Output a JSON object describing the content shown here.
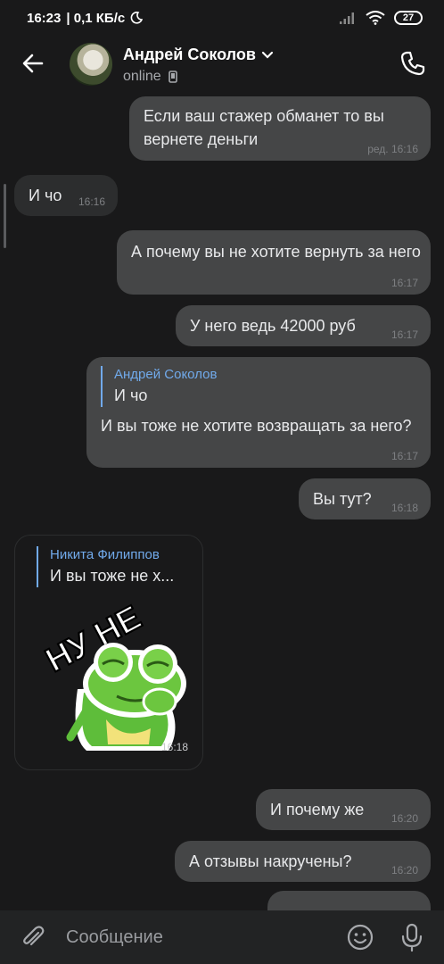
{
  "statusbar": {
    "time": "16:23",
    "speed": "| 0,1 КБ/с",
    "battery": "27"
  },
  "header": {
    "name": "Андрей Соколов",
    "status": "online"
  },
  "messages": [
    {
      "dir": "out",
      "text": "Если ваш стажер обманет то вы вернете деньги",
      "time": "ред. 16:16"
    },
    {
      "dir": "in",
      "text": "И чо",
      "time": "16:16"
    },
    {
      "dir": "out",
      "text": "А почему вы не хотите вернуть за него",
      "time": "16:17"
    },
    {
      "dir": "out",
      "text": "У него ведь 42000 руб",
      "time": "16:17"
    },
    {
      "dir": "out",
      "reply_name": "Андрей Соколов",
      "reply_text": "И чо",
      "text": "И вы тоже не хотите возвращать за него?",
      "time": "16:17"
    },
    {
      "dir": "out",
      "text": "Вы тут?",
      "time": "16:18"
    },
    {
      "dir": "in",
      "reply_name": "Никита Филиппов",
      "reply_text": "И вы тоже не х...",
      "sticker_text": "НУ НЕ",
      "time": "16:18"
    },
    {
      "dir": "out",
      "text": "И почему же",
      "time": "16:20"
    },
    {
      "dir": "out",
      "text": "А отзывы накручены?",
      "time": "16:20"
    }
  ],
  "composer": {
    "placeholder": "Сообщение"
  },
  "colors": {
    "background": "#19191a",
    "bubble_out": "#454647",
    "bubble_in": "#2c2d2e",
    "accent": "#71aaeb"
  }
}
